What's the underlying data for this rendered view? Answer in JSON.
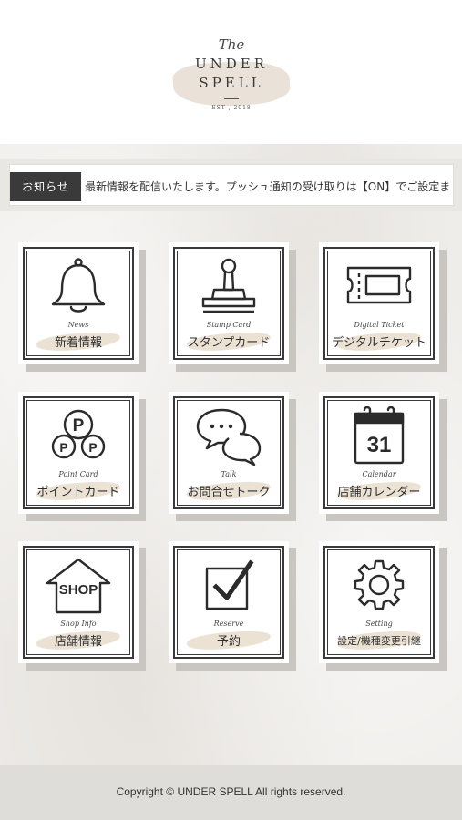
{
  "header": {
    "logo": {
      "script": "The",
      "line1": "UNDER",
      "line2": "SPELL",
      "est": "EST , 2018"
    }
  },
  "ticker": {
    "label": "お知らせ",
    "text": "最新情報を配信いたします。プッシュ通知の受け取りは【ON】でご設定ま"
  },
  "tiles": [
    {
      "subtitle": "News",
      "label": "新着情報",
      "icon": "bell-icon"
    },
    {
      "subtitle": "Stamp Card",
      "label": "スタンプカード",
      "icon": "stamp-icon"
    },
    {
      "subtitle": "Digital Ticket",
      "label": "デジタルチケット",
      "icon": "ticket-icon"
    },
    {
      "subtitle": "Point Card",
      "label": "ポイントカード",
      "icon": "points-icon"
    },
    {
      "subtitle": "Talk",
      "label": "お問合せトーク",
      "icon": "chat-icon"
    },
    {
      "subtitle": "Calendar",
      "label": "店舗カレンダー",
      "icon": "calendar-icon",
      "icon_text": "31"
    },
    {
      "subtitle": "Shop Info",
      "label": "店舗情報",
      "icon": "shop-icon",
      "icon_text": "SHOP"
    },
    {
      "subtitle": "Reserve",
      "label": "予約",
      "icon": "checkbox-icon"
    },
    {
      "subtitle": "Setting",
      "label": "設定/機種変更引継",
      "icon": "gear-icon"
    }
  ],
  "footer": {
    "copyright": "Copyright © UNDER SPELL All rights reserved."
  }
}
